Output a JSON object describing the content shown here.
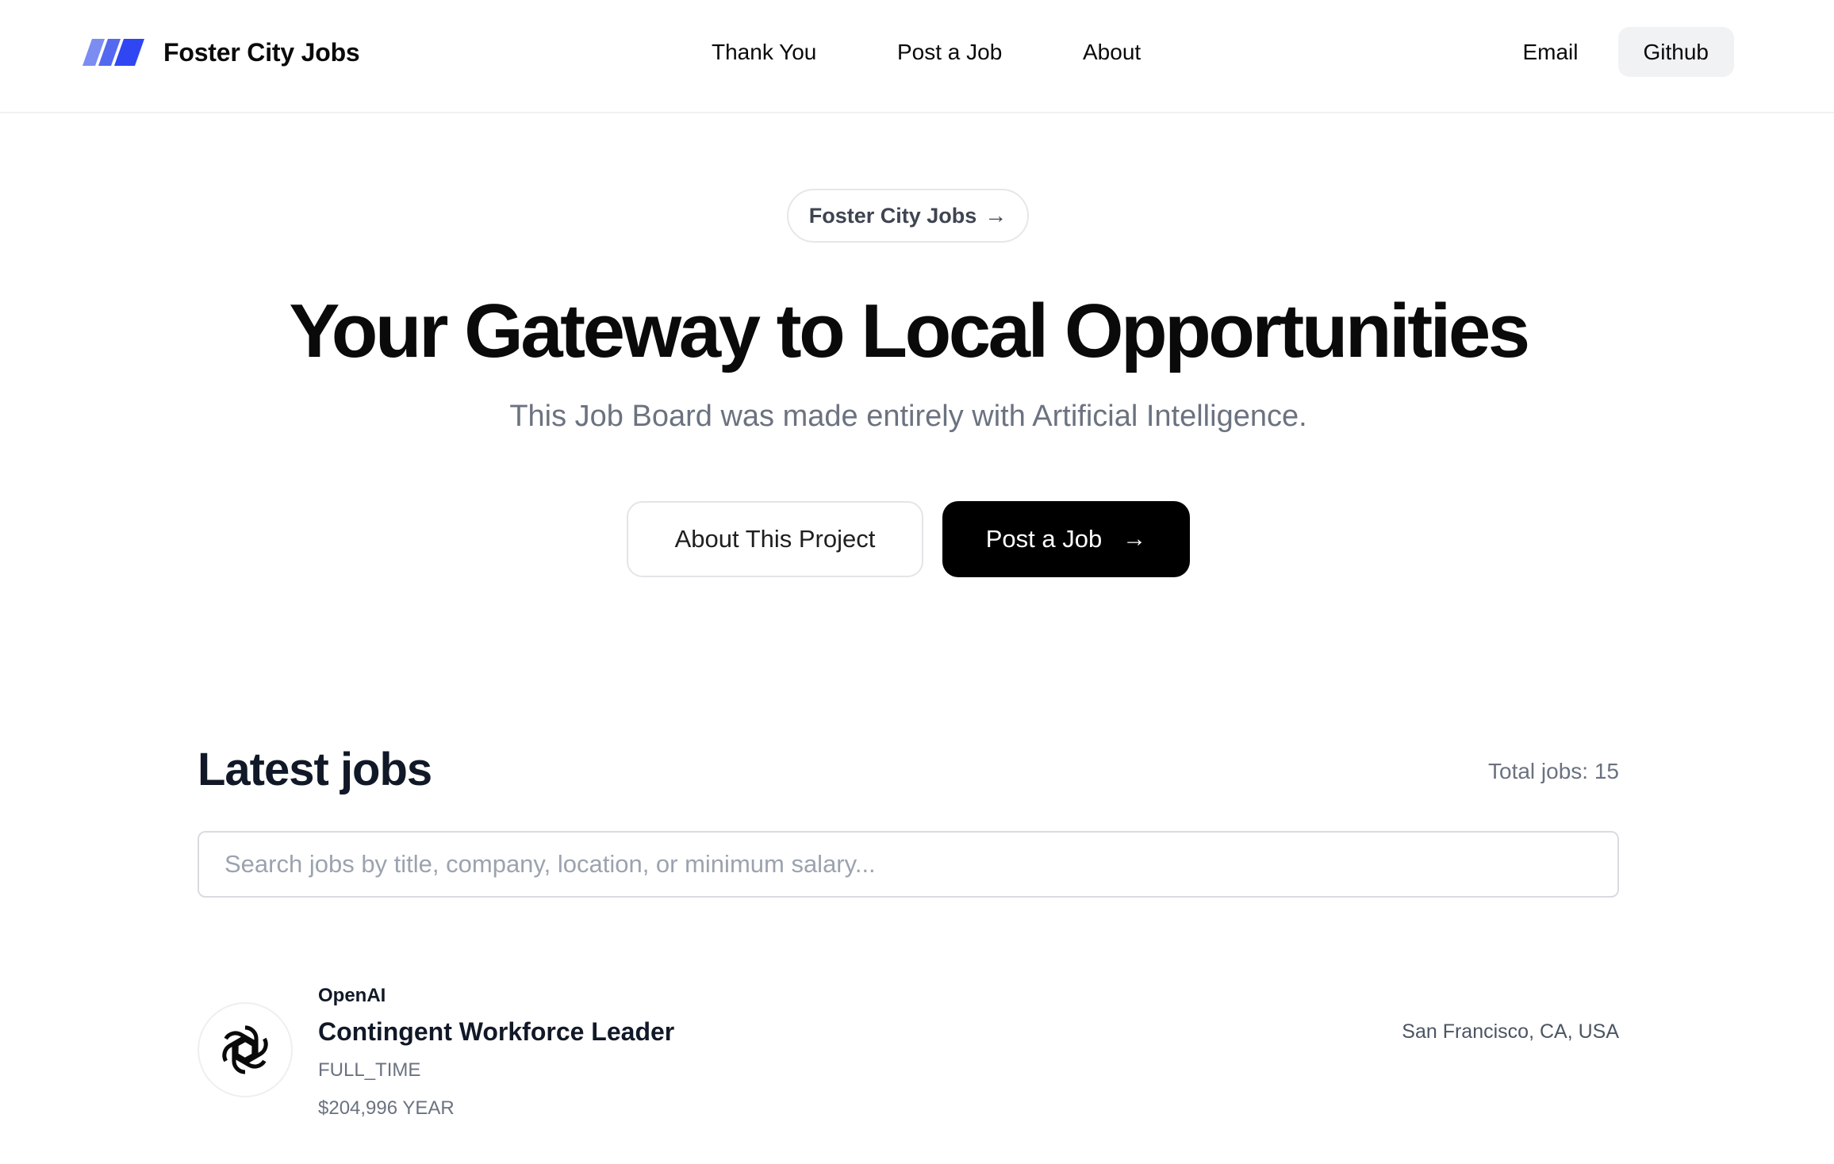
{
  "header": {
    "brand_name": "Foster City Jobs",
    "logo_colors": [
      "#7b8cf3",
      "#5468f0",
      "#2f46f2"
    ],
    "nav": [
      {
        "label": "Thank You"
      },
      {
        "label": "Post a Job"
      },
      {
        "label": "About"
      }
    ],
    "email_label": "Email",
    "github_label": "Github"
  },
  "hero": {
    "pill_label": "Foster City Jobs",
    "pill_arrow": "→",
    "title": "Your Gateway to Local Opportunities",
    "subtitle": "This Job Board was made entirely with Artificial Intelligence.",
    "about_button_label": "About This Project",
    "post_button_label": "Post a Job",
    "post_button_arrow": "→"
  },
  "jobs": {
    "title": "Latest jobs",
    "total_label": "Total jobs: 15",
    "search": {
      "placeholder": "Search jobs by title, company, location, or minimum salary...",
      "value": ""
    },
    "items": [
      {
        "company": "OpenAI",
        "logo_icon": "openai-logo-icon",
        "title": "Contingent Workforce Leader",
        "employment_type": "FULL_TIME",
        "salary": "$204,996 YEAR",
        "location": "San Francisco, CA, USA"
      }
    ]
  }
}
